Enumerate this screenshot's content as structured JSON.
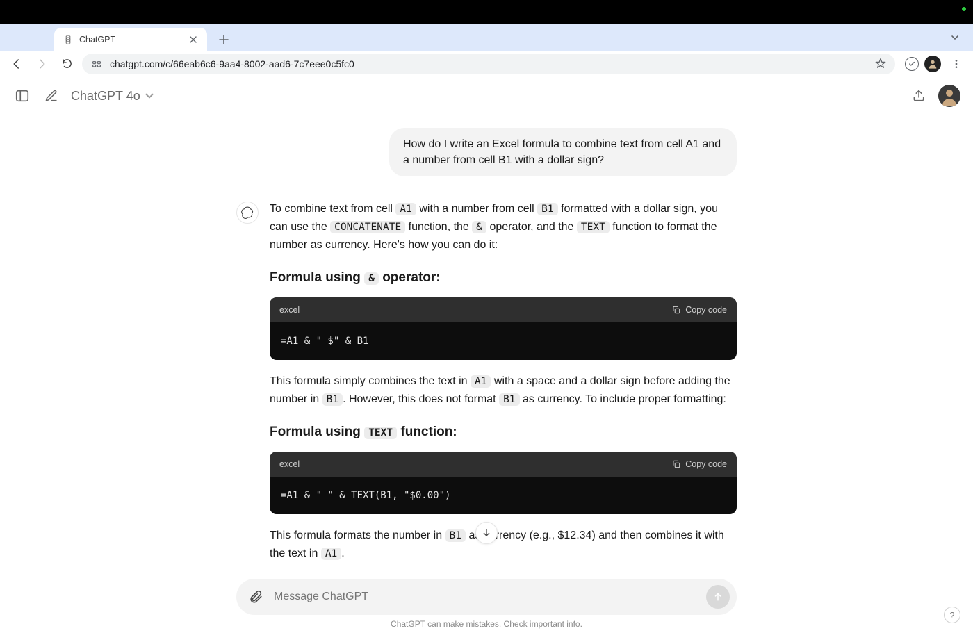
{
  "browser": {
    "tab_title": "ChatGPT",
    "url": "chatgpt.com/c/66eab6c6-9aa4-8002-aad6-7c7eee0c5fc0"
  },
  "app": {
    "model_label": "ChatGPT 4o"
  },
  "conversation": {
    "user_message": "How do I write an Excel formula to combine text from cell A1 and a number from cell B1 with a dollar sign?",
    "intro_p1a": "To combine text from cell ",
    "intro_c1": "A1",
    "intro_p1b": " with a number from cell ",
    "intro_c2": "B1",
    "intro_p1c": " formatted with a dollar sign, you can use the ",
    "intro_c3": "CONCATENATE",
    "intro_p1d": " function, the ",
    "intro_c4": "&",
    "intro_p1e": " operator, and the ",
    "intro_c5": "TEXT",
    "intro_p1f": " function to format the number as currency. Here's how you can do it:",
    "h1a": "Formula using ",
    "h1_code": "&",
    "h1b": " operator:",
    "code1_lang": "excel",
    "code1_copy": "Copy code",
    "code1_body": "=A1 & \" $\" & B1",
    "p2a": "This formula simply combines the text in ",
    "p2_c1": "A1",
    "p2b": " with a space and a dollar sign before adding the number in ",
    "p2_c2": "B1",
    "p2c": ". However, this does not format ",
    "p2_c3": "B1",
    "p2d": " as currency. To include proper formatting:",
    "h2a": "Formula using ",
    "h2_code": "TEXT",
    "h2b": " function:",
    "code2_lang": "excel",
    "code2_copy": "Copy code",
    "code2_body": "=A1 & \" \" & TEXT(B1, \"$0.00\")",
    "p3a": "This formula formats the number in ",
    "p3_c1": "B1",
    "p3b": " as currency (e.g., $12.34) and then combines it with the text in ",
    "p3_c2": "A1",
    "p3c": "."
  },
  "composer": {
    "placeholder": "Message ChatGPT"
  },
  "footer": {
    "disclaimer": "ChatGPT can make mistakes. Check important info."
  }
}
